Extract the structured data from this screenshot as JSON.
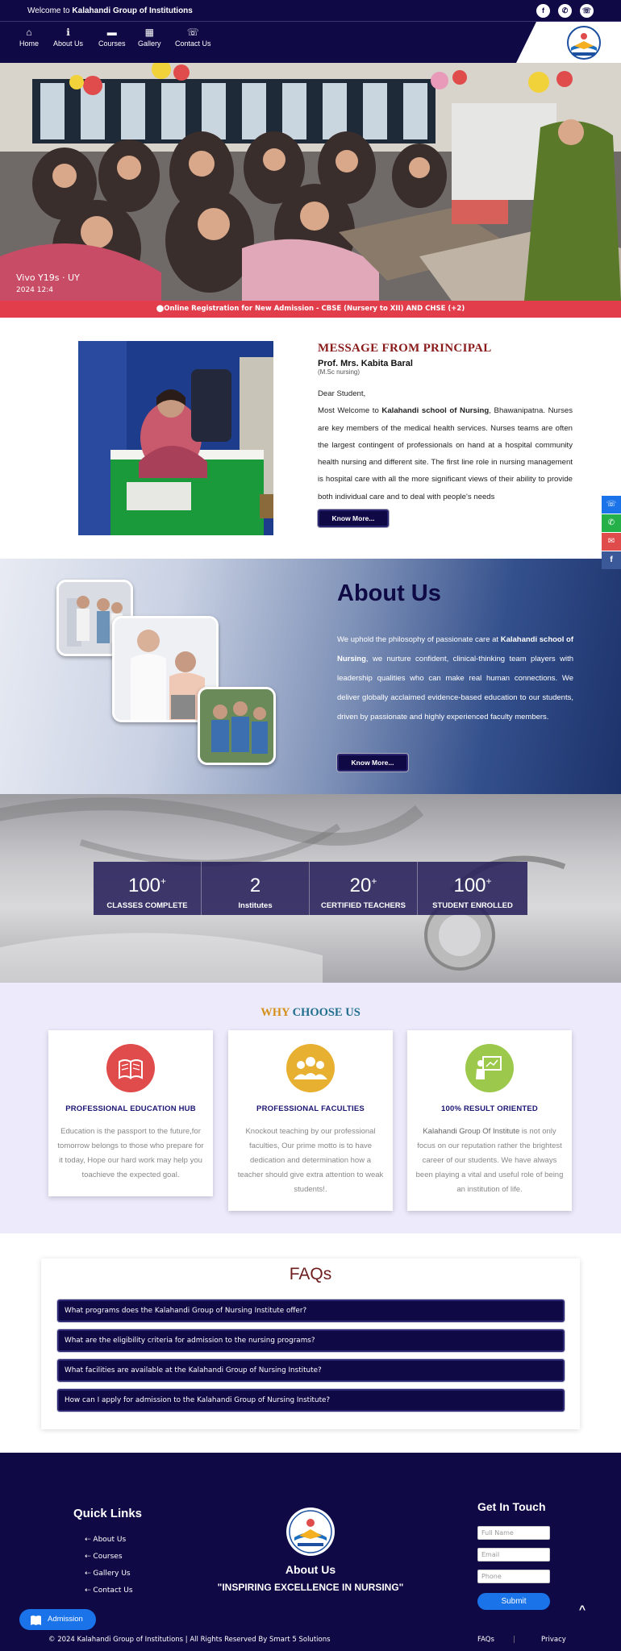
{
  "topbar": {
    "welcome_prefix": "Welcome to",
    "institution": "Kalahandi Group of Institutions",
    "social": [
      {
        "icon": "facebook-icon",
        "glyph": "f"
      },
      {
        "icon": "whatsapp-icon",
        "glyph": "✆"
      },
      {
        "icon": "phone-icon",
        "glyph": "☏"
      }
    ]
  },
  "nav": {
    "items": [
      {
        "label": "Home",
        "icon": "home-icon",
        "glyph": "⌂"
      },
      {
        "label": "About Us",
        "icon": "info-icon",
        "glyph": "ℹ"
      },
      {
        "label": "Courses",
        "icon": "book-icon",
        "glyph": "▬"
      },
      {
        "label": "Gallery",
        "icon": "calendar-icon",
        "glyph": "▦"
      },
      {
        "label": "Contact Us",
        "icon": "phone-icon",
        "glyph": "☏"
      }
    ]
  },
  "hero": {
    "overlay_line1": "Vivo Y19s · UY",
    "overlay_line2": "2024 12:4"
  },
  "marquee": "⬤Online Registration for New Admission - CBSE (Nursery to XII) AND CHSE (+2)",
  "principal": {
    "title": "MESSAGE FROM PRINCIPAL",
    "name": "Prof. Mrs. Kabita Baral",
    "qualification": "(M.Sc nursing)",
    "greeting": "Dear Student,",
    "body_pre": "Most Welcome to ",
    "body_bold": "Kalahandi school of Nursing",
    "body_post": ", Bhawanipatna. Nurses are key members of the medical health services. Nurses teams are often the largest contingent of professionals on hand at a hospital community health nursing and different site. The first line role in nursing management is hospital care with all the more significant views of their ability to provide both individual care and to deal with people's needs",
    "button": "Know More..."
  },
  "about": {
    "title": "About Us",
    "body_pre": "We uphold the philosophy of passionate care at ",
    "body_bold": "Kalahandi school of Nursing",
    "body_post": ", we nurture confident, clinical-thinking team players with leadership qualities who can make real human connections. We deliver globally acclaimed evidence-based education to our students, driven by passionate and highly experienced faculty members.",
    "button": "Know More..."
  },
  "stats": [
    {
      "value": "100",
      "sup": "+",
      "label": "CLASSES COMPLETE"
    },
    {
      "value": "2",
      "sup": "",
      "label": "Institutes"
    },
    {
      "value": "20",
      "sup": "+",
      "label": "CERTIFIED TEACHERS"
    },
    {
      "value": "100",
      "sup": "+",
      "label": "STUDENT ENROLLED"
    }
  ],
  "why": {
    "title_a": "WHY ",
    "title_b": "CHOOSE US",
    "color_a": "#d4901a",
    "color_b": "#1f6e8c",
    "cards": [
      {
        "title": "PROFESSIONAL EDUCATION HUB",
        "text": "Education is the passport to the future,for tomorrow belongs to those who prepare for it today, Hope our hard work may help you toachieve the expected goal.",
        "icon": "open-book-icon",
        "color": "#e04b4b"
      },
      {
        "title": "PROFESSIONAL FACULTIES",
        "text": "Knockout teaching by our professional faculties, Our prime motto is to have dedication and determination how a teacher should give extra attention to weak students!.",
        "icon": "group-icon",
        "color": "#e8b030"
      },
      {
        "title": "100% RESULT ORIENTED",
        "text_bold": "Kalahandi Group Of Institute",
        "text": " is not only focus on our reputation rather the brightest career of our students. We have always been playing a vital and useful role of being an institution of life.",
        "icon": "teacher-board-icon",
        "color": "#9cc84c"
      }
    ]
  },
  "faq": {
    "title": "FAQs",
    "items": [
      "What programs does the Kalahandi Group of Nursing Institute offer?",
      "What are the eligibility criteria for admission to the nursing programs?",
      "What facilities are available at the Kalahandi Group of Nursing Institute?",
      "How can I apply for admission to the Kalahandi Group of Nursing Institute?"
    ]
  },
  "footer": {
    "quick_links_title": "Quick Links",
    "links": [
      "About Us",
      "Courses",
      "Gallery Us",
      "Contact Us"
    ],
    "about_title": "About Us",
    "motto": "\"INSPIRING EXCELLENCE IN NURSING\"",
    "contact_title": "Get In Touch",
    "placeholders": {
      "name": "Full Name",
      "email": "Email",
      "phone": "Phone"
    },
    "submit": "Submit",
    "admission": "Admission",
    "copyright": "©  2024 Kalahandi Group of Institutions | All Rights Reserved By Smart 5 Solutions",
    "bottom_links": [
      "FAQs",
      "|",
      "Privacy"
    ]
  },
  "side_buttons": [
    {
      "icon": "phone-icon",
      "glyph": "☏",
      "color": "#1a73e8"
    },
    {
      "icon": "whatsapp-icon",
      "glyph": "✆",
      "color": "#25b04a"
    },
    {
      "icon": "mail-icon",
      "glyph": "✉",
      "color": "#e04b4b"
    },
    {
      "icon": "facebook-icon",
      "glyph": "f",
      "color": "#3b5998"
    }
  ],
  "scroll_top": "^"
}
